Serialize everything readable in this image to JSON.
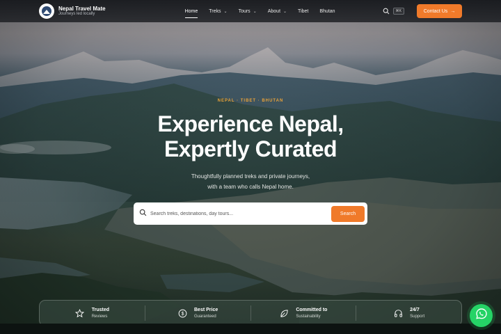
{
  "brand": {
    "name": "Nepal Travel Mate",
    "tagline": "Journeys led locally"
  },
  "nav": {
    "items": [
      {
        "label": "Home",
        "active": true
      },
      {
        "label": "Treks",
        "dropdown": true
      },
      {
        "label": "Tours",
        "dropdown": true
      },
      {
        "label": "About",
        "dropdown": true
      },
      {
        "label": "Tibet"
      },
      {
        "label": "Bhutan"
      }
    ],
    "shortcut": "⌘K",
    "contact_label": "Contact Us"
  },
  "hero": {
    "kicker": "NEPAL · TIBET · BHUTAN",
    "headline_line1": "Experience Nepal,",
    "headline_line2": "Expertly Curated",
    "sub_line1": "Thoughtfully planned treks and private journeys,",
    "sub_line2": "with a team who calls Nepal home."
  },
  "search": {
    "placeholder": "Search treks, destinations, day tours...",
    "button": "Search"
  },
  "trust": [
    {
      "icon": "star-icon",
      "title": "Trusted",
      "sub": "Reviews"
    },
    {
      "icon": "dollar-icon",
      "title": "Best Price",
      "sub": "Guaranteed"
    },
    {
      "icon": "leaf-icon",
      "title": "Committed to",
      "sub": "Sustainability"
    },
    {
      "icon": "headphones-icon",
      "title": "24/7",
      "sub": "Support"
    }
  ],
  "colors": {
    "accent": "#f07a2a",
    "kicker": "#e9a23a",
    "whatsapp": "#25d366"
  }
}
